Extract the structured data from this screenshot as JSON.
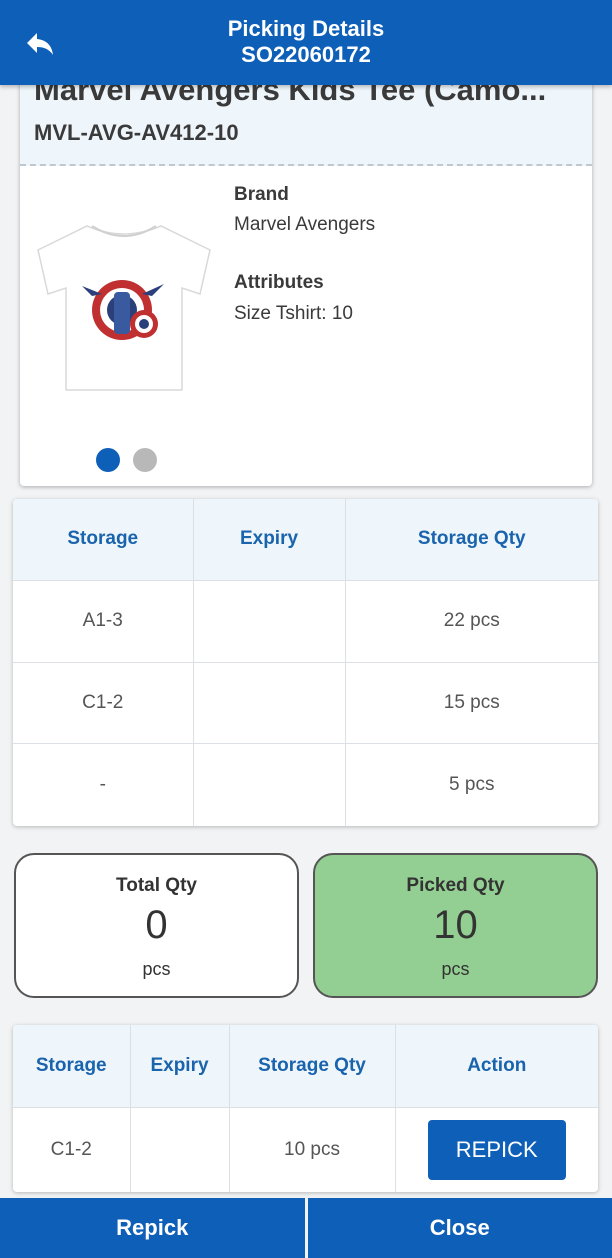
{
  "header": {
    "title": "Picking Details",
    "order_number": "SO22060172",
    "back_icon": "back-arrow-icon"
  },
  "product": {
    "name": "Marvel Avengers Kids Tee (Camo...",
    "sku": "MVL-AVG-AV412-10",
    "brand_label": "Brand",
    "brand_value": "Marvel Avengers",
    "attributes_label": "Attributes",
    "attributes_value": "Size Tshirt: 10",
    "carousel": {
      "total": 2,
      "active": 1
    }
  },
  "storage_table": {
    "headers": [
      "Storage",
      "Expiry",
      "Storage Qty"
    ],
    "rows": [
      [
        "A1-3",
        "",
        "22 pcs"
      ],
      [
        "C1-2",
        "",
        "15 pcs"
      ],
      [
        "-",
        "",
        "5 pcs"
      ]
    ]
  },
  "total_qty": {
    "label": "Total Qty",
    "value": "0",
    "unit": "pcs"
  },
  "picked_qty": {
    "label": "Picked Qty",
    "value": "10",
    "unit": "pcs"
  },
  "picked_table": {
    "headers": [
      "Storage",
      "Expiry",
      "Storage Qty",
      "Action"
    ],
    "rows": [
      {
        "storage": "C1-2",
        "expiry": "",
        "qty": "10 pcs",
        "action": "REPICK"
      }
    ]
  },
  "footer": {
    "repick_label": "Repick",
    "close_label": "Close"
  },
  "colors": {
    "primary": "#0e5fb8",
    "header_text": "#1a63ad",
    "picked_bg": "#93cf92",
    "light_bg": "#eef6fb"
  }
}
